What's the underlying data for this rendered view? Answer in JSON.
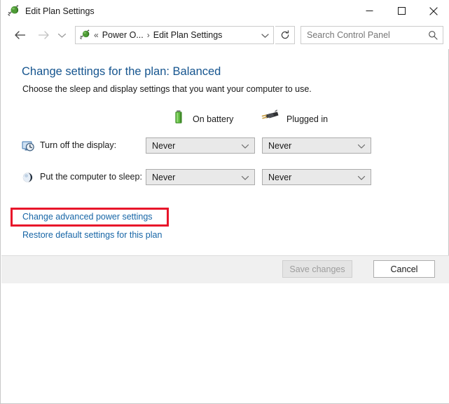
{
  "window": {
    "title": "Edit Plan Settings",
    "icon": "power-plug-icon",
    "controls": {
      "minimize": "minimize-icon",
      "maximize": "maximize-icon",
      "close": "close-icon"
    }
  },
  "navigation": {
    "back": "back-arrow-icon",
    "forward": "forward-arrow-icon",
    "recent": "recent-locations-chevron-icon",
    "up": "up-arrow-icon",
    "refresh": "refresh-icon",
    "address": {
      "icon": "power-plug-icon",
      "overflow_chevrons": "«",
      "separator": "›",
      "crumb1": "Power O...",
      "crumb2": "Edit Plan Settings",
      "dropdown": "chevron-down-icon"
    }
  },
  "search": {
    "placeholder": "Search Control Panel",
    "value": "",
    "icon": "search-icon"
  },
  "main": {
    "title": "Change settings for the plan: Balanced",
    "subtitle": "Choose the sleep and display settings that you want your computer to use.",
    "columns": [
      {
        "label": "On battery",
        "icon": "battery-icon"
      },
      {
        "label": "Plugged in",
        "icon": "power-plug-icon"
      }
    ],
    "rows": [
      {
        "label": "Turn off the display:",
        "icon": "display-clock-icon",
        "on_battery": "Never",
        "plugged_in": "Never"
      },
      {
        "label": "Put the computer to sleep:",
        "icon": "sleep-moon-icon",
        "on_battery": "Never",
        "plugged_in": "Never"
      }
    ],
    "links": [
      {
        "label": "Change advanced power settings",
        "highlighted": true
      },
      {
        "label": "Restore default settings for this plan",
        "highlighted": false
      }
    ]
  },
  "footer": {
    "save_label": "Save changes",
    "cancel_label": "Cancel"
  },
  "colors": {
    "heading": "#16558f",
    "link": "#1665a6",
    "annotation": "#e8152a",
    "accent": "#1e7ba6",
    "dropdown_bg": "#e9e9e9",
    "footer_bg": "#f0f0f0"
  }
}
